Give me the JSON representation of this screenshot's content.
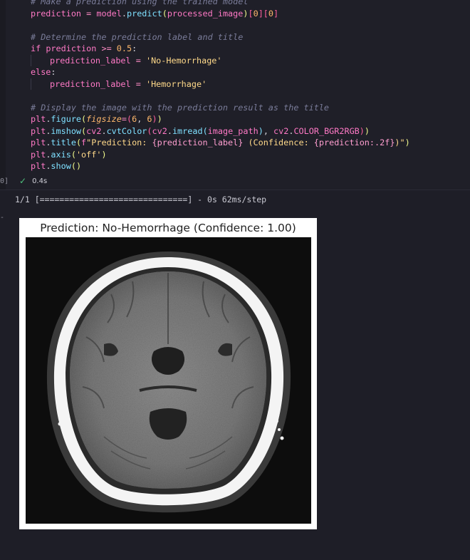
{
  "cell": {
    "execution_count": "0]",
    "status_time": "0.4s",
    "code": [
      {
        "indent": 0,
        "tokens": [
          {
            "c": "cm",
            "t": "# Make a prediction using the trained model"
          }
        ]
      },
      {
        "indent": 0,
        "tokens": [
          {
            "c": "var",
            "t": "prediction"
          },
          {
            "c": "pn",
            "t": " "
          },
          {
            "c": "op",
            "t": "="
          },
          {
            "c": "pn",
            "t": " "
          },
          {
            "c": "var",
            "t": "model"
          },
          {
            "c": "pn",
            "t": "."
          },
          {
            "c": "fn",
            "t": "predict"
          },
          {
            "c": "par",
            "t": "("
          },
          {
            "c": "var",
            "t": "processed_image"
          },
          {
            "c": "par",
            "t": ")"
          },
          {
            "c": "brk",
            "t": "["
          },
          {
            "c": "num",
            "t": "0"
          },
          {
            "c": "brk",
            "t": "]["
          },
          {
            "c": "num",
            "t": "0"
          },
          {
            "c": "brk",
            "t": "]"
          }
        ]
      },
      {
        "indent": 0,
        "tokens": []
      },
      {
        "indent": 0,
        "tokens": [
          {
            "c": "cm",
            "t": "# Determine the prediction label and title"
          }
        ]
      },
      {
        "indent": 0,
        "tokens": [
          {
            "c": "kw",
            "t": "if"
          },
          {
            "c": "pn",
            "t": " "
          },
          {
            "c": "var",
            "t": "prediction"
          },
          {
            "c": "pn",
            "t": " "
          },
          {
            "c": "op",
            "t": ">="
          },
          {
            "c": "pn",
            "t": " "
          },
          {
            "c": "num",
            "t": "0.5"
          },
          {
            "c": "pn",
            "t": ":"
          }
        ]
      },
      {
        "indent": 1,
        "tokens": [
          {
            "c": "var",
            "t": "prediction_label"
          },
          {
            "c": "pn",
            "t": " "
          },
          {
            "c": "op",
            "t": "="
          },
          {
            "c": "pn",
            "t": " "
          },
          {
            "c": "str",
            "t": "'No-Hemorrhage'"
          }
        ]
      },
      {
        "indent": 0,
        "tokens": [
          {
            "c": "kw",
            "t": "else"
          },
          {
            "c": "pn",
            "t": ":"
          }
        ]
      },
      {
        "indent": 1,
        "tokens": [
          {
            "c": "var",
            "t": "prediction_label"
          },
          {
            "c": "pn",
            "t": " "
          },
          {
            "c": "op",
            "t": "="
          },
          {
            "c": "pn",
            "t": " "
          },
          {
            "c": "str",
            "t": "'Hemorrhage'"
          }
        ]
      },
      {
        "indent": 0,
        "tokens": []
      },
      {
        "indent": 0,
        "tokens": [
          {
            "c": "cm",
            "t": "# Display the image with the prediction result as the title"
          }
        ]
      },
      {
        "indent": 0,
        "tokens": [
          {
            "c": "var",
            "t": "plt"
          },
          {
            "c": "pn",
            "t": "."
          },
          {
            "c": "fn",
            "t": "figure"
          },
          {
            "c": "par",
            "t": "("
          },
          {
            "c": "kwarg",
            "t": "figsize"
          },
          {
            "c": "op",
            "t": "="
          },
          {
            "c": "brk",
            "t": "("
          },
          {
            "c": "num",
            "t": "6"
          },
          {
            "c": "pn",
            "t": ", "
          },
          {
            "c": "num",
            "t": "6"
          },
          {
            "c": "brk",
            "t": ")"
          },
          {
            "c": "par",
            "t": ")"
          }
        ]
      },
      {
        "indent": 0,
        "tokens": [
          {
            "c": "var",
            "t": "plt"
          },
          {
            "c": "pn",
            "t": "."
          },
          {
            "c": "fn",
            "t": "imshow"
          },
          {
            "c": "par",
            "t": "("
          },
          {
            "c": "var",
            "t": "cv2"
          },
          {
            "c": "pn",
            "t": "."
          },
          {
            "c": "fn",
            "t": "cvtColor"
          },
          {
            "c": "brk",
            "t": "("
          },
          {
            "c": "var",
            "t": "cv2"
          },
          {
            "c": "pn",
            "t": "."
          },
          {
            "c": "fn",
            "t": "imread"
          },
          {
            "c": "fn",
            "t": "("
          },
          {
            "c": "var",
            "t": "image_path"
          },
          {
            "c": "fn",
            "t": ")"
          },
          {
            "c": "pn",
            "t": ", "
          },
          {
            "c": "var",
            "t": "cv2"
          },
          {
            "c": "pn",
            "t": "."
          },
          {
            "c": "var",
            "t": "COLOR_BGR2RGB"
          },
          {
            "c": "brk",
            "t": ")"
          },
          {
            "c": "par",
            "t": ")"
          }
        ]
      },
      {
        "indent": 0,
        "tokens": [
          {
            "c": "var",
            "t": "plt"
          },
          {
            "c": "pn",
            "t": "."
          },
          {
            "c": "fn",
            "t": "title"
          },
          {
            "c": "par",
            "t": "("
          },
          {
            "c": "kw",
            "t": "f"
          },
          {
            "c": "fstr",
            "t": "\"Prediction: "
          },
          {
            "c": "fvar",
            "t": "{prediction_label}"
          },
          {
            "c": "fstr",
            "t": " (Confidence: "
          },
          {
            "c": "fvar",
            "t": "{prediction:.2f}"
          },
          {
            "c": "fstr",
            "t": ")\""
          },
          {
            "c": "par",
            "t": ")"
          }
        ]
      },
      {
        "indent": 0,
        "tokens": [
          {
            "c": "var",
            "t": "plt"
          },
          {
            "c": "pn",
            "t": "."
          },
          {
            "c": "fn",
            "t": "axis"
          },
          {
            "c": "par",
            "t": "("
          },
          {
            "c": "str",
            "t": "'off'"
          },
          {
            "c": "par",
            "t": ")"
          }
        ]
      },
      {
        "indent": 0,
        "tokens": [
          {
            "c": "var",
            "t": "plt"
          },
          {
            "c": "pn",
            "t": "."
          },
          {
            "c": "fn",
            "t": "show"
          },
          {
            "c": "par",
            "t": "()"
          }
        ]
      }
    ]
  },
  "output": {
    "progress_line": "1/1 [==============================] - 0s 62ms/step",
    "figure_title": "Prediction: No-Hemorrhage (Confidence: 1.00)",
    "image_icon": "ct-brain-scan-image"
  },
  "colors": {
    "background": "#1e1e27",
    "success_check": "#4ec07c"
  }
}
